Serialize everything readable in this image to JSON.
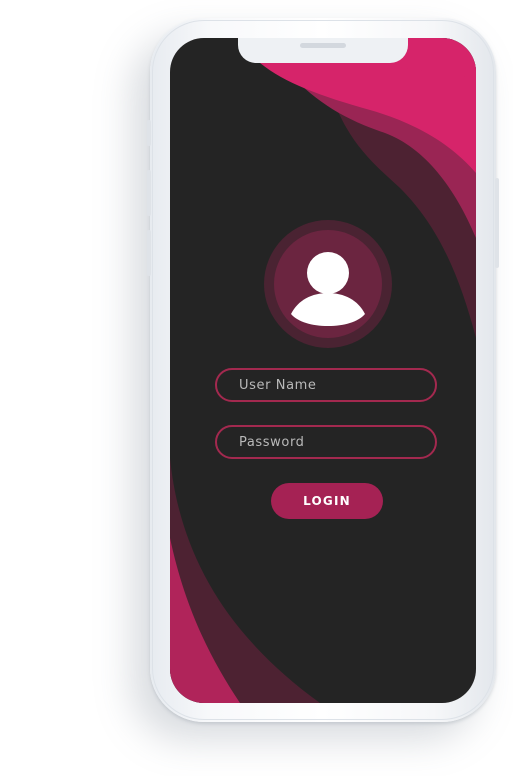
{
  "login_form": {
    "username_placeholder": "User Name",
    "password_placeholder": "Password",
    "login_label": "LOGIN"
  },
  "icons": {
    "avatar": "user-profile-icon"
  },
  "colors": {
    "screen_background": "#242424",
    "accent_pink": "#d6246a",
    "field_border": "#a3294f",
    "button_background": "#a52254",
    "avatar_fill": "#6b2540",
    "avatar_ring": "#4a2332",
    "wave_dark": "#4d2232"
  }
}
